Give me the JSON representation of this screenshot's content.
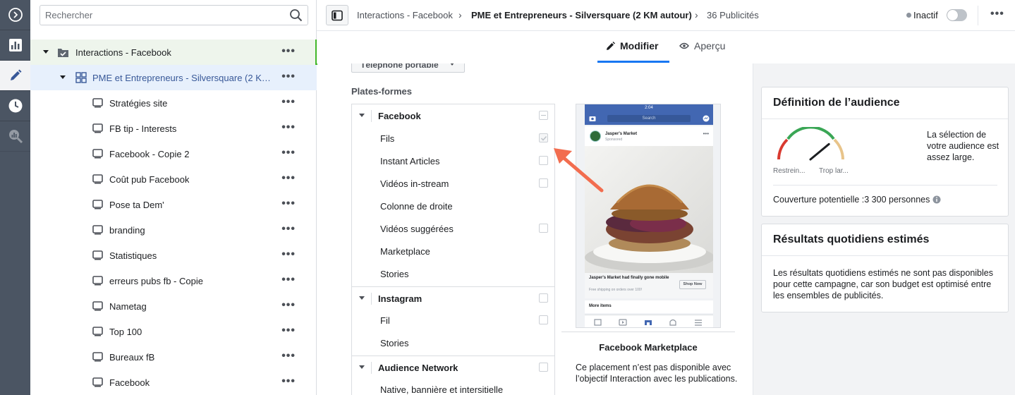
{
  "colors": {
    "rail_bg": "#4b5563",
    "accent_blue": "#1877f2",
    "campaign_highlight": "#42b72a",
    "arrow": "#f26d4f"
  },
  "rail": {
    "items": [
      "chevron-circle-icon",
      "bar-chart-icon",
      "pencil-icon",
      "clock-icon",
      "search-chart-icon"
    ],
    "active_index": 2
  },
  "tree": {
    "search_placeholder": "Rechercher",
    "campaign": "Interactions - Facebook",
    "adset": "PME et Entrepreneurs - Silversquare (2 KM autour)",
    "ads": [
      "Stratégies site",
      "FB tip - Interests",
      "Facebook - Copie 2",
      "Coût pub Facebook",
      "Pose ta Dem'",
      "branding",
      "Statistiques",
      "erreurs pubs fb - Copie",
      "Nametag",
      "Top 100",
      "Bureaux fB",
      "Facebook"
    ],
    "more_label": "•••"
  },
  "header": {
    "crumb1": "Interactions - Facebook",
    "crumb2": "PME et Entrepreneurs - Silversquare (2 KM autour)",
    "crumb3": "36 Publicités",
    "status": "Inactif",
    "more_label": "•••"
  },
  "tabs": {
    "edit": "Modifier",
    "preview": "Aperçu"
  },
  "editor": {
    "device": "Téléphone portable",
    "platforms_title": "Plates-formes",
    "platforms": [
      {
        "type": "head",
        "label": "Facebook",
        "check": "dash"
      },
      {
        "type": "item",
        "label": "Fils",
        "check": "checked"
      },
      {
        "type": "item",
        "label": "Instant Articles",
        "check": "empty"
      },
      {
        "type": "item",
        "label": "Vidéos in-stream",
        "check": "empty"
      },
      {
        "type": "item",
        "label": "Colonne de droite",
        "check": "none"
      },
      {
        "type": "item",
        "label": "Vidéos suggérées",
        "check": "empty"
      },
      {
        "type": "item",
        "label": "Marketplace",
        "check": "none"
      },
      {
        "type": "item",
        "label": "Stories",
        "check": "none"
      },
      {
        "type": "head",
        "label": "Instagram",
        "check": "empty"
      },
      {
        "type": "item",
        "label": "Fil",
        "check": "empty"
      },
      {
        "type": "item",
        "label": "Stories",
        "check": "none"
      },
      {
        "type": "head",
        "label": "Audience Network",
        "check": "empty"
      },
      {
        "type": "item",
        "label": "Native, bannière et intersitielle",
        "check": "none"
      }
    ],
    "phone": {
      "time": "2:04",
      "search": "Search",
      "page_name": "Jasper's Market",
      "sponsored": "Sponsored",
      "cta_title": "Jasper's Market had finally gone mobile",
      "cta_sub": "Free shipping on orders over 100!",
      "shop": "Shop Now",
      "more_items": "More items"
    },
    "placement_title": "Facebook Marketplace",
    "placement_desc": "Ce placement n’est pas disponible avec l’objectif Interaction avec les publications."
  },
  "audience": {
    "title": "Définition de l’audience",
    "gauge_left": "Restrein...",
    "gauge_right": "Trop lar...",
    "gauge_level": 0.78,
    "description": "La sélection de votre audience est assez large.",
    "reach": "Couverture potentielle :3 300 personnes"
  },
  "results": {
    "title": "Résultats quotidiens estimés",
    "text": "Les résultats quotidiens estimés ne sont pas disponibles pour cette campagne, car son budget est optimisé entre les ensembles de publicités."
  }
}
